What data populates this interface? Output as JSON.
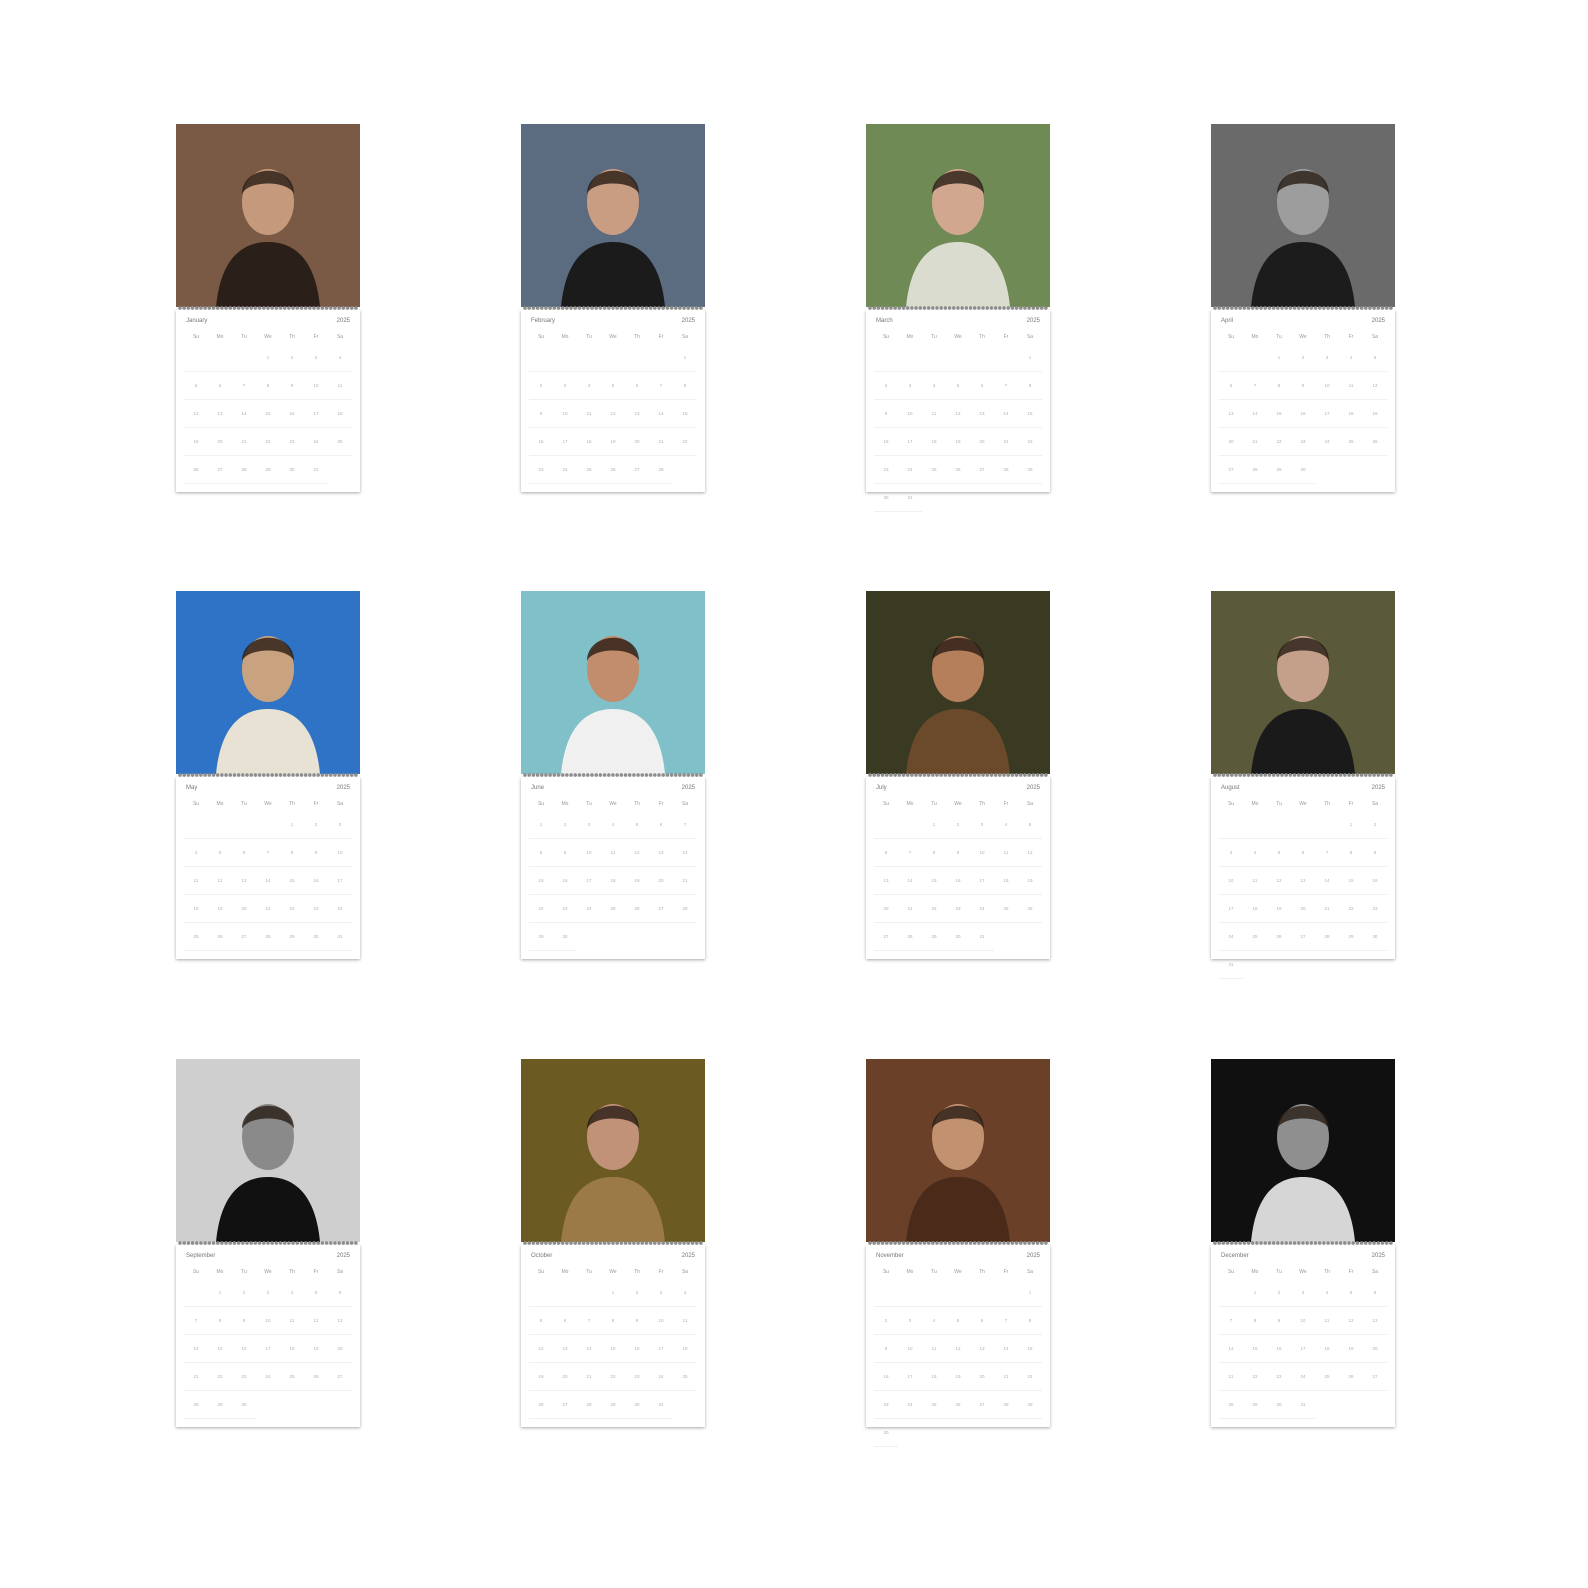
{
  "year": "2025",
  "weekdays": [
    "Su",
    "Mo",
    "Tu",
    "We",
    "Th",
    "Fr",
    "Sa"
  ],
  "months": [
    {
      "name": "January",
      "start": 3,
      "days": 31,
      "photo": {
        "bg": "#7a5a44",
        "fg": "#2a1f19",
        "skin": "#c59a7c"
      }
    },
    {
      "name": "February",
      "start": 6,
      "days": 28,
      "photo": {
        "bg": "#5b6b80",
        "fg": "#1b1b1b",
        "skin": "#c99d82"
      }
    },
    {
      "name": "March",
      "start": 6,
      "days": 31,
      "photo": {
        "bg": "#6f8a55",
        "fg": "#d9dccf",
        "skin": "#d1a88f"
      }
    },
    {
      "name": "April",
      "start": 2,
      "days": 30,
      "photo": {
        "bg": "#6a6a6a",
        "fg": "#1c1c1c",
        "skin": "#9d9d9d"
      }
    },
    {
      "name": "May",
      "start": 4,
      "days": 31,
      "photo": {
        "bg": "#2f73c6",
        "fg": "#e8e2d4",
        "skin": "#c9a27f"
      }
    },
    {
      "name": "June",
      "start": 0,
      "days": 30,
      "photo": {
        "bg": "#7fc0c9",
        "fg": "#f0f0f0",
        "skin": "#c28d6c"
      }
    },
    {
      "name": "July",
      "start": 2,
      "days": 31,
      "photo": {
        "bg": "#3a3a22",
        "fg": "#6b4a2c",
        "skin": "#b57f5c"
      }
    },
    {
      "name": "August",
      "start": 5,
      "days": 31,
      "photo": {
        "bg": "#5a5a3a",
        "fg": "#1a1a1a",
        "skin": "#c4a08a"
      }
    },
    {
      "name": "September",
      "start": 1,
      "days": 30,
      "photo": {
        "bg": "#cfcfcf",
        "fg": "#111111",
        "skin": "#8a8a8a"
      }
    },
    {
      "name": "October",
      "start": 3,
      "days": 31,
      "photo": {
        "bg": "#6b5a22",
        "fg": "#9b7a48",
        "skin": "#c29278"
      }
    },
    {
      "name": "November",
      "start": 6,
      "days": 30,
      "photo": {
        "bg": "#6a4028",
        "fg": "#4a2a18",
        "skin": "#c2916f"
      }
    },
    {
      "name": "December",
      "start": 1,
      "days": 31,
      "photo": {
        "bg": "#101010",
        "fg": "#d6d6d6",
        "skin": "#8f8f8f"
      }
    }
  ]
}
